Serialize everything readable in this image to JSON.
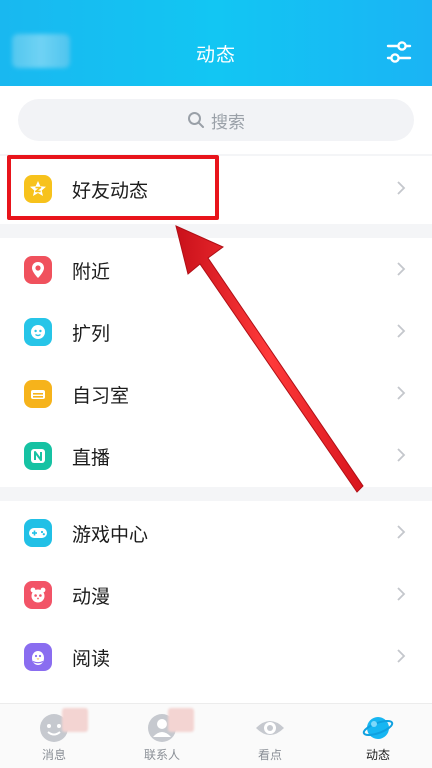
{
  "header": {
    "title": "动态",
    "settings_icon": "sliders-icon"
  },
  "search": {
    "placeholder": "搜索",
    "icon": "search-icon"
  },
  "sections": [
    {
      "items": [
        {
          "label": "好友动态",
          "icon": "friend-star-icon",
          "color": "#f7c21c"
        }
      ]
    },
    {
      "items": [
        {
          "label": "附近",
          "icon": "location-pin-icon",
          "color": "#f0515d"
        },
        {
          "label": "扩列",
          "icon": "face-plus-icon",
          "color": "#27c5e8"
        },
        {
          "label": "自习室",
          "icon": "bed-icon",
          "color": "#f6b31b"
        },
        {
          "label": "直播",
          "icon": "live-n-icon",
          "color": "#16c2a3"
        }
      ]
    },
    {
      "items": [
        {
          "label": "游戏中心",
          "icon": "gamepad-icon",
          "color": "#21c0e6"
        },
        {
          "label": "动漫",
          "icon": "panda-icon",
          "color": "#f25467"
        },
        {
          "label": "阅读",
          "icon": "penguin-icon",
          "color": "#8a6df0"
        }
      ]
    }
  ],
  "tabbar": [
    {
      "label": "消息",
      "icon": "message-face-icon",
      "active": false
    },
    {
      "label": "联系人",
      "icon": "contact-person-icon",
      "active": false
    },
    {
      "label": "看点",
      "icon": "eye-icon",
      "active": false
    },
    {
      "label": "动态",
      "icon": "planet-icon",
      "active": true
    }
  ],
  "colors": {
    "header": "#19b8f0",
    "highlight": "#e8141b",
    "arrow": "#ee1c24"
  }
}
